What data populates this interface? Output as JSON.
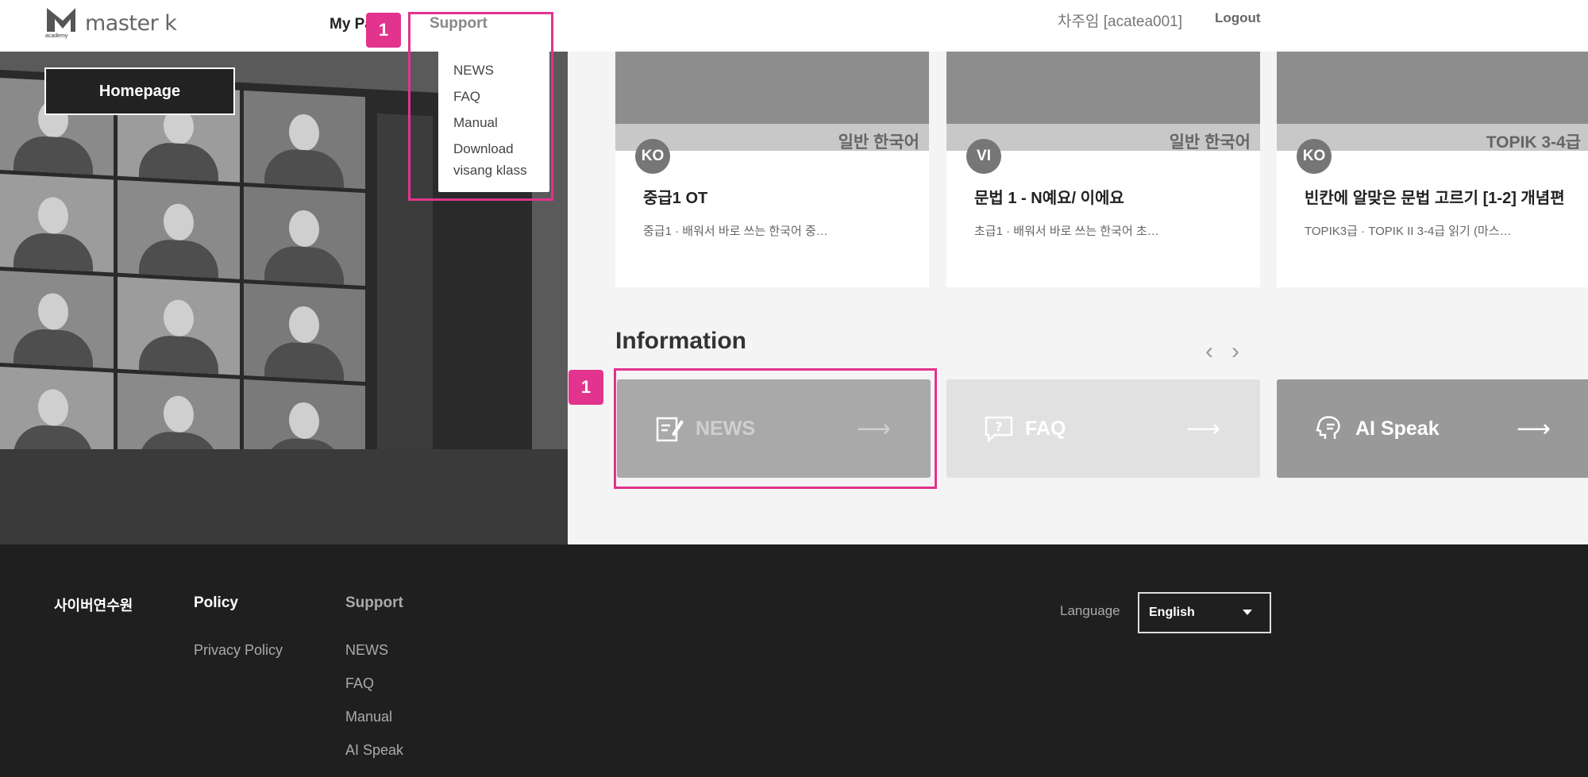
{
  "header": {
    "logo_text": "master k",
    "logo_sub": "academy",
    "nav_mypage": "My Pa",
    "nav_support": "Support",
    "user_name": "차주임 [acatea001]",
    "logout": "Logout"
  },
  "support_menu": {
    "items": [
      "NEWS",
      "FAQ",
      "Manual",
      "Download visang klass"
    ]
  },
  "hero": {
    "homepage_label": "Homepage"
  },
  "courses": [
    {
      "badge": "KO",
      "category": "일반 한국어",
      "title": "중급1 OT",
      "subtitle": "중급1 · 배워서 바로 쓰는 한국어 중…"
    },
    {
      "badge": "VI",
      "category": "일반 한국어",
      "title": "문법 1 - N예요/ 이에요",
      "subtitle": "초급1 · 배워서 바로 쓰는 한국어 초…"
    },
    {
      "badge": "KO",
      "category": "TOPIK 3-4급",
      "title": "빈칸에 알맞은 문법 고르기 [1-2] 개념편",
      "subtitle": "TOPIK3급 · TOPIK II 3-4급 읽기 (마스…"
    }
  ],
  "information": {
    "title": "Information",
    "prev_icon": "chevron-left-icon",
    "next_icon": "chevron-right-icon",
    "cards": [
      {
        "label": "NEWS",
        "icon": "edit-note-icon",
        "arrow": "⟶"
      },
      {
        "label": "FAQ",
        "icon": "question-chat-icon",
        "arrow": "⟶"
      },
      {
        "label": "AI Speak",
        "icon": "speaking-head-icon",
        "arrow": "⟶"
      }
    ]
  },
  "annotations": {
    "step_label": "1",
    "highlight_color": "#e2338d"
  },
  "footer": {
    "brand": "사이버연수원",
    "policy_heading": "Policy",
    "policy_links": [
      "Privacy Policy"
    ],
    "support_heading": "Support",
    "support_links": [
      "NEWS",
      "FAQ",
      "Manual",
      "AI Speak"
    ],
    "language_label": "Language",
    "language_value": "English"
  }
}
